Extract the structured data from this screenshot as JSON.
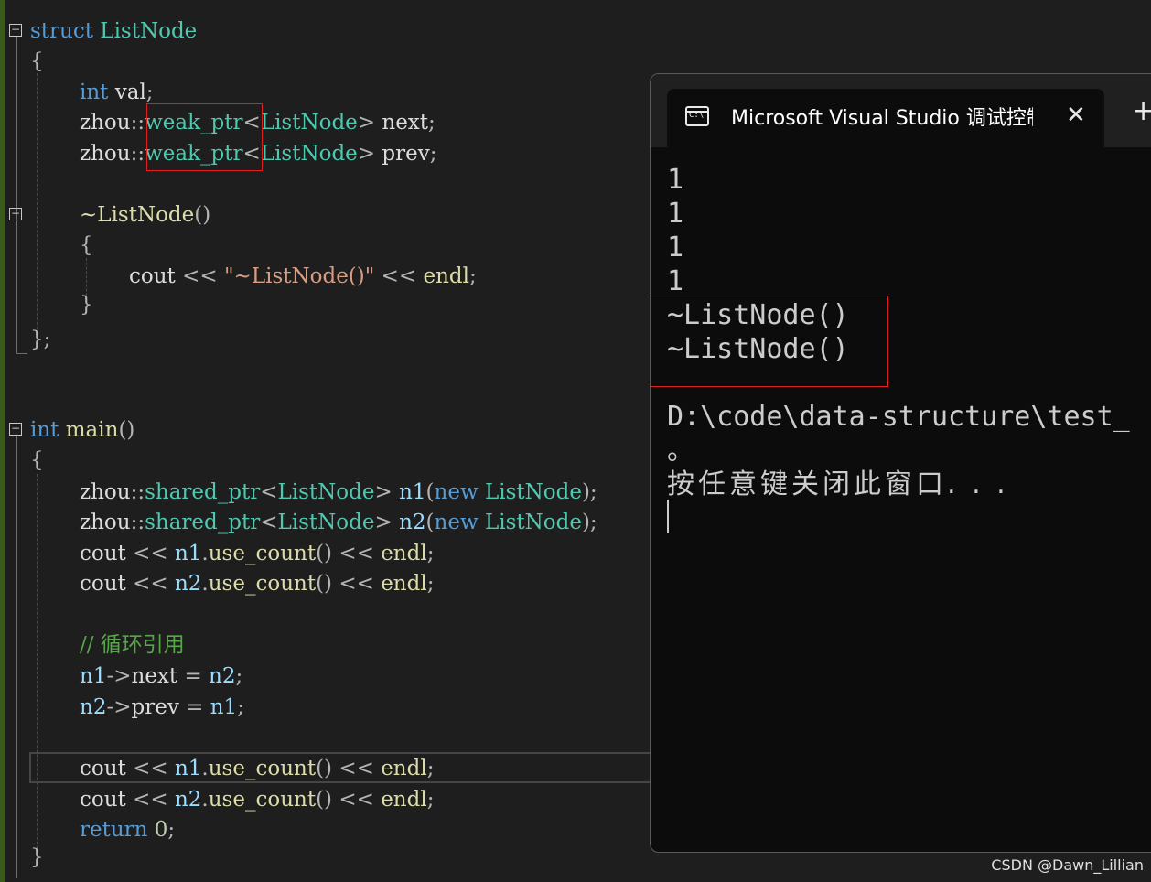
{
  "editor": {
    "lines": [
      {
        "segments": [
          {
            "c": "kw",
            "t": "struct "
          },
          {
            "c": "ty",
            "t": "ListNode"
          }
        ]
      },
      {
        "segments": [
          {
            "c": "op",
            "t": "{"
          }
        ]
      },
      {
        "segments": [
          {
            "c": "kw",
            "t": "int "
          },
          {
            "c": "pl",
            "t": "val"
          },
          {
            "c": "op",
            "t": ";"
          }
        ]
      },
      {
        "segments": [
          {
            "c": "pl",
            "t": "zhou"
          },
          {
            "c": "op",
            "t": "::"
          },
          {
            "c": "ty",
            "t": "weak_ptr"
          },
          {
            "c": "op",
            "t": "<"
          },
          {
            "c": "ty",
            "t": "ListNode"
          },
          {
            "c": "op",
            "t": "> "
          },
          {
            "c": "pl",
            "t": "next"
          },
          {
            "c": "op",
            "t": ";"
          }
        ]
      },
      {
        "segments": [
          {
            "c": "pl",
            "t": "zhou"
          },
          {
            "c": "op",
            "t": "::"
          },
          {
            "c": "ty",
            "t": "weak_ptr"
          },
          {
            "c": "op",
            "t": "<"
          },
          {
            "c": "ty",
            "t": "ListNode"
          },
          {
            "c": "op",
            "t": "> "
          },
          {
            "c": "pl",
            "t": "prev"
          },
          {
            "c": "op",
            "t": ";"
          }
        ]
      },
      {
        "segments": [
          {
            "c": "fn",
            "t": "~ListNode"
          },
          {
            "c": "op",
            "t": "()"
          }
        ]
      },
      {
        "segments": [
          {
            "c": "op",
            "t": "{"
          }
        ]
      },
      {
        "segments": [
          {
            "c": "pl",
            "t": "cout "
          },
          {
            "c": "op",
            "t": "<< "
          },
          {
            "c": "str",
            "t": "\"~ListNode()\""
          },
          {
            "c": "op",
            "t": " << "
          },
          {
            "c": "fn",
            "t": "endl"
          },
          {
            "c": "op",
            "t": ";"
          }
        ]
      },
      {
        "segments": [
          {
            "c": "op",
            "t": "}"
          }
        ]
      },
      {
        "segments": [
          {
            "c": "op",
            "t": "};"
          }
        ]
      },
      {
        "segments": [
          {
            "c": "kw",
            "t": "int "
          },
          {
            "c": "fn",
            "t": "main"
          },
          {
            "c": "op",
            "t": "()"
          }
        ]
      },
      {
        "segments": [
          {
            "c": "op",
            "t": "{"
          }
        ]
      },
      {
        "segments": [
          {
            "c": "pl",
            "t": "zhou"
          },
          {
            "c": "op",
            "t": "::"
          },
          {
            "c": "ty",
            "t": "shared_ptr"
          },
          {
            "c": "op",
            "t": "<"
          },
          {
            "c": "ty",
            "t": "ListNode"
          },
          {
            "c": "op",
            "t": "> "
          },
          {
            "c": "var",
            "t": "n1"
          },
          {
            "c": "op",
            "t": "("
          },
          {
            "c": "kw",
            "t": "new "
          },
          {
            "c": "ty",
            "t": "ListNode"
          },
          {
            "c": "op",
            "t": ");"
          }
        ]
      },
      {
        "segments": [
          {
            "c": "pl",
            "t": "zhou"
          },
          {
            "c": "op",
            "t": "::"
          },
          {
            "c": "ty",
            "t": "shared_ptr"
          },
          {
            "c": "op",
            "t": "<"
          },
          {
            "c": "ty",
            "t": "ListNode"
          },
          {
            "c": "op",
            "t": "> "
          },
          {
            "c": "var",
            "t": "n2"
          },
          {
            "c": "op",
            "t": "("
          },
          {
            "c": "kw",
            "t": "new "
          },
          {
            "c": "ty",
            "t": "ListNode"
          },
          {
            "c": "op",
            "t": ");"
          }
        ]
      },
      {
        "segments": [
          {
            "c": "pl",
            "t": "cout "
          },
          {
            "c": "op",
            "t": "<< "
          },
          {
            "c": "var",
            "t": "n1"
          },
          {
            "c": "op",
            "t": "."
          },
          {
            "c": "fn",
            "t": "use_count"
          },
          {
            "c": "op",
            "t": "() << "
          },
          {
            "c": "fn",
            "t": "endl"
          },
          {
            "c": "op",
            "t": ";"
          }
        ]
      },
      {
        "segments": [
          {
            "c": "pl",
            "t": "cout "
          },
          {
            "c": "op",
            "t": "<< "
          },
          {
            "c": "var",
            "t": "n2"
          },
          {
            "c": "op",
            "t": "."
          },
          {
            "c": "fn",
            "t": "use_count"
          },
          {
            "c": "op",
            "t": "() << "
          },
          {
            "c": "fn",
            "t": "endl"
          },
          {
            "c": "op",
            "t": ";"
          }
        ]
      },
      {
        "segments": [
          {
            "c": "cm",
            "t": "// 循环引用"
          }
        ]
      },
      {
        "segments": [
          {
            "c": "var",
            "t": "n1"
          },
          {
            "c": "op",
            "t": "->"
          },
          {
            "c": "pl",
            "t": "next "
          },
          {
            "c": "op",
            "t": "= "
          },
          {
            "c": "var",
            "t": "n2"
          },
          {
            "c": "op",
            "t": ";"
          }
        ]
      },
      {
        "segments": [
          {
            "c": "var",
            "t": "n2"
          },
          {
            "c": "op",
            "t": "->"
          },
          {
            "c": "pl",
            "t": "prev "
          },
          {
            "c": "op",
            "t": "= "
          },
          {
            "c": "var",
            "t": "n1"
          },
          {
            "c": "op",
            "t": ";"
          }
        ]
      },
      {
        "segments": [
          {
            "c": "pl",
            "t": "cout "
          },
          {
            "c": "op",
            "t": "<< "
          },
          {
            "c": "var",
            "t": "n1"
          },
          {
            "c": "op",
            "t": "."
          },
          {
            "c": "fn",
            "t": "use_count"
          },
          {
            "c": "op",
            "t": "() << "
          },
          {
            "c": "fn",
            "t": "endl"
          },
          {
            "c": "op",
            "t": ";"
          }
        ]
      },
      {
        "segments": [
          {
            "c": "pl",
            "t": "cout "
          },
          {
            "c": "op",
            "t": "<< "
          },
          {
            "c": "var",
            "t": "n2"
          },
          {
            "c": "op",
            "t": "."
          },
          {
            "c": "fn",
            "t": "use_count"
          },
          {
            "c": "op",
            "t": "() << "
          },
          {
            "c": "fn",
            "t": "endl"
          },
          {
            "c": "op",
            "t": ";"
          }
        ]
      },
      {
        "segments": [
          {
            "c": "kw",
            "t": "return "
          },
          {
            "c": "num",
            "t": "0"
          },
          {
            "c": "op",
            "t": ";"
          }
        ]
      },
      {
        "segments": [
          {
            "c": "op",
            "t": "}"
          }
        ]
      }
    ]
  },
  "console": {
    "tab_title": "Microsoft Visual Studio 调试控制台",
    "close_glyph": "✕",
    "new_tab_glyph": "+",
    "icon_text": "C:\\",
    "output": [
      "1",
      "1",
      "1",
      "1",
      "~ListNode()",
      "~ListNode()",
      "",
      "D:\\code\\data-structure\\test_",
      "。",
      "按任意键关闭此窗口. . ."
    ]
  },
  "watermark": "CSDN @Dawn_Lillian",
  "colors": {
    "keyword": "#569cd6",
    "type": "#4ec9b0",
    "string": "#d69d85",
    "comment": "#57a64a",
    "highlight_box": "#e02020"
  }
}
